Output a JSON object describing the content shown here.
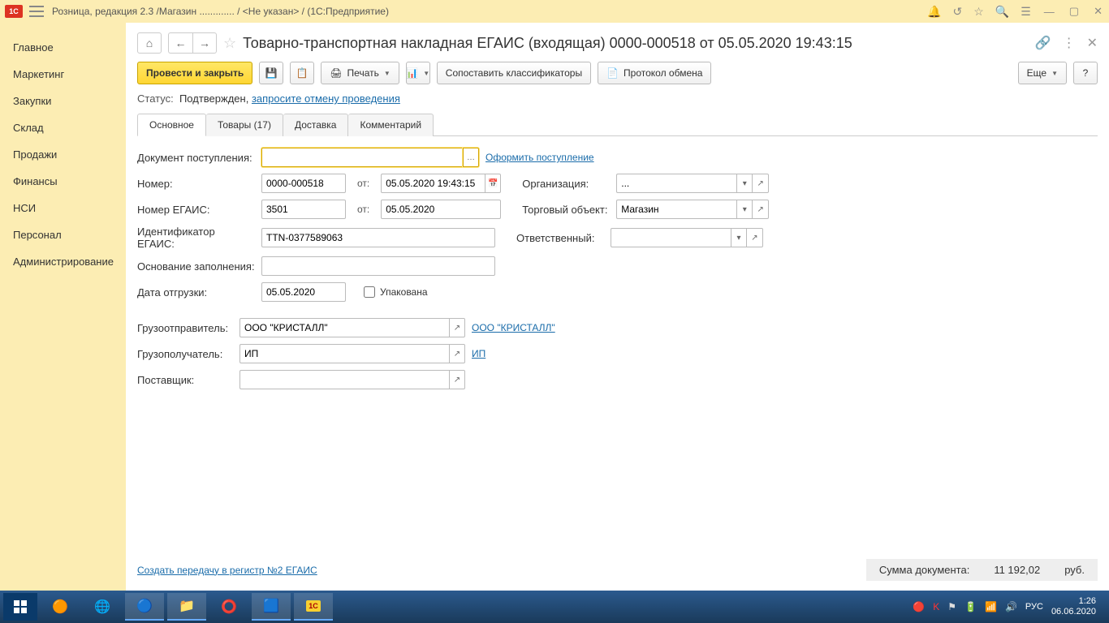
{
  "titlebar": {
    "logo": "1C",
    "text": "Розница, редакция 2.3 /Магазин ............. / <Не указан> /  (1С:Предприятие)"
  },
  "sidebar": {
    "items": [
      "Главное",
      "Маркетинг",
      "Закупки",
      "Склад",
      "Продажи",
      "Финансы",
      "НСИ",
      "Персонал",
      "Администрирование"
    ]
  },
  "document": {
    "title": "Товарно-транспортная накладная ЕГАИС (входящая) 0000-000518 от 05.05.2020 19:43:15"
  },
  "toolbar": {
    "post_close": "Провести и закрыть",
    "print": "Печать",
    "compare": "Сопоставить классификаторы",
    "protocol": "Протокол обмена",
    "more": "Еще",
    "help": "?"
  },
  "status": {
    "label": "Статус:",
    "value": "Подтвержден,",
    "link": "запросите отмену проведения"
  },
  "tabs": [
    "Основное",
    "Товары (17)",
    "Доставка",
    "Комментарий"
  ],
  "form": {
    "doc_receipt_label": "Документ поступления:",
    "doc_receipt": "",
    "create_receipt_link": "Оформить поступление",
    "number_label": "Номер:",
    "number": "0000-000518",
    "from_label": "от:",
    "number_date": "05.05.2020 19:43:15",
    "org_label": "Организация:",
    "org": "...",
    "egais_num_label": "Номер ЕГАИС:",
    "egais_num": "3501",
    "egais_date": "05.05.2020",
    "trade_object_label": "Торговый объект:",
    "trade_object": "Магазин",
    "egais_id_label": "Идентификатор ЕГАИС:",
    "egais_id": "TTN-0377589063",
    "responsible_label": "Ответственный:",
    "responsible": "",
    "basis_label": "Основание заполнения:",
    "basis": "",
    "ship_date_label": "Дата отгрузки:",
    "ship_date": "05.05.2020",
    "packed_label": "Упакована",
    "sender_label": "Грузоотправитель:",
    "sender": "ООО \"КРИСТАЛЛ\"",
    "sender_link": "ООО \"КРИСТАЛЛ\"",
    "recipient_label": "Грузополучатель:",
    "recipient": "ИП",
    "recipient_link": "ИП",
    "supplier_label": "Поставщик:",
    "supplier": ""
  },
  "footer": {
    "link": "Создать передачу в регистр №2 ЕГАИС",
    "total_label": "Сумма документа:",
    "total_value": "11 192,02",
    "total_cur": "руб."
  },
  "taskbar": {
    "lang": "РУС",
    "time": "1:26",
    "date": "06.06.2020"
  }
}
